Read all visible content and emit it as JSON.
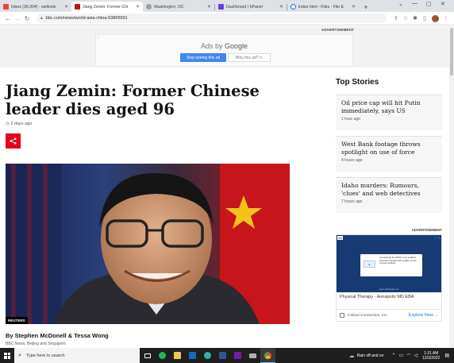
{
  "tabs": [
    {
      "title": "Inbox (36,004) - wellesle",
      "color": "#ea4335"
    },
    {
      "title": "Jiang Zemin: Former Chi",
      "color": "#bb1919"
    },
    {
      "title": "Washington, DC",
      "color": "#4285f4"
    },
    {
      "title": "Dashboard | hPanel",
      "color": "#673de6"
    },
    {
      "title": "index.html - Files - File E",
      "color": "#1a73e8"
    }
  ],
  "omnibox": {
    "url": "bbc.com/news/world-asia-china-63805991"
  },
  "ad_banner": {
    "label": "ADVERTISEMENT",
    "ads_by": "Ads by",
    "google": "Google",
    "stop_label": "Stop seeing this ad",
    "why_label": "Why this ad? ⊳"
  },
  "article": {
    "headline": "Jiang Zemin: Former Chinese leader dies aged 96",
    "timestamp": "2 days ago",
    "photo_credit": "REUTERS",
    "byline": "By Stephen McDonell & Tessa Wong",
    "byline_sub": "BBC News, Beijing and Singapore"
  },
  "top_stories": {
    "title": "Top Stories",
    "items": [
      {
        "headline": "Oil price cap will hit Putin immediately, says US",
        "time": "1 hour ago"
      },
      {
        "headline": "West Bank footage throws spotlight on use of force",
        "time": "4 hours ago"
      },
      {
        "headline": "Idaho murders: Rumours, 'clues' and web detectives",
        "time": "7 hours ago"
      }
    ]
  },
  "side_ad": {
    "label": "ADVERTISEMENT",
    "tag": "Ad",
    "card_text": "Considering the DMVs most qualified Physical Therapist with quality-of-care focused facilities",
    "card_url": "www.criticalcare.net",
    "headline": "Physical Therapy - Annapolis MD EBA",
    "company": "Critical Connection, Inc.",
    "explore": "Explore New ..."
  },
  "taskbar": {
    "search_placeholder": "Type here to search",
    "weather": "Rain off and on",
    "time": "1:31 AM",
    "date": "12/3/2022"
  }
}
